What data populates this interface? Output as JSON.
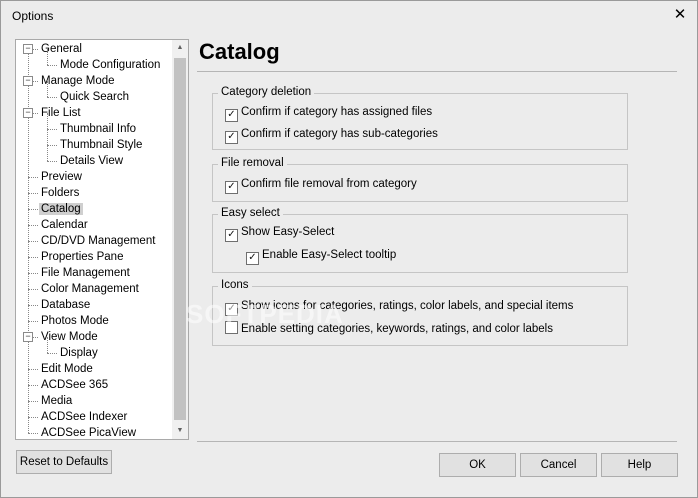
{
  "window": {
    "title": "Options",
    "close_glyph": "✕"
  },
  "tree": {
    "items": [
      {
        "label": "General",
        "level": 0,
        "expandable": true
      },
      {
        "label": "Mode Configuration",
        "level": 1
      },
      {
        "label": "Manage Mode",
        "level": 0,
        "expandable": true
      },
      {
        "label": "Quick Search",
        "level": 1
      },
      {
        "label": "File List",
        "level": 0,
        "expandable": true
      },
      {
        "label": "Thumbnail Info",
        "level": 1
      },
      {
        "label": "Thumbnail Style",
        "level": 1
      },
      {
        "label": "Details View",
        "level": 1
      },
      {
        "label": "Preview",
        "level": 0
      },
      {
        "label": "Folders",
        "level": 0
      },
      {
        "label": "Catalog",
        "level": 0,
        "selected": true
      },
      {
        "label": "Calendar",
        "level": 0
      },
      {
        "label": "CD/DVD Management",
        "level": 0
      },
      {
        "label": "Properties Pane",
        "level": 0
      },
      {
        "label": "File Management",
        "level": 0
      },
      {
        "label": "Color Management",
        "level": 0
      },
      {
        "label": "Database",
        "level": 0
      },
      {
        "label": "Photos Mode",
        "level": 0
      },
      {
        "label": "View Mode",
        "level": 0,
        "expandable": true
      },
      {
        "label": "Display",
        "level": 1
      },
      {
        "label": "Edit Mode",
        "level": 0
      },
      {
        "label": "ACDSee 365",
        "level": 0
      },
      {
        "label": "Media",
        "level": 0
      },
      {
        "label": "ACDSee Indexer",
        "level": 0
      },
      {
        "label": "ACDSee PicaView",
        "level": 0
      }
    ],
    "expander_glyph": "−",
    "scroll_up_glyph": "▲",
    "scroll_down_glyph": "▼"
  },
  "page": {
    "title": "Catalog"
  },
  "groups": {
    "category_deletion": {
      "title": "Category deletion",
      "items": [
        {
          "label": "Confirm if category has assigned files",
          "checked": true
        },
        {
          "label": "Confirm if category has sub-categories",
          "checked": true
        }
      ]
    },
    "file_removal": {
      "title": "File removal",
      "items": [
        {
          "label": "Confirm file removal from category",
          "checked": true
        }
      ]
    },
    "easy_select": {
      "title": "Easy select",
      "items": [
        {
          "label": "Show Easy-Select",
          "checked": true
        },
        {
          "label": "Enable Easy-Select tooltip",
          "checked": true
        }
      ]
    },
    "icons": {
      "title": "Icons",
      "items": [
        {
          "label": "Show icons for categories, ratings, color labels, and special items",
          "checked": true
        },
        {
          "label": "Enable setting categories, keywords, ratings, and color labels",
          "checked": false
        }
      ]
    }
  },
  "check_glyph": "✓",
  "buttons": {
    "reset": "Reset to Defaults",
    "ok": "OK",
    "cancel": "Cancel",
    "help": "Help"
  },
  "watermark": "SOFTPEDIA"
}
